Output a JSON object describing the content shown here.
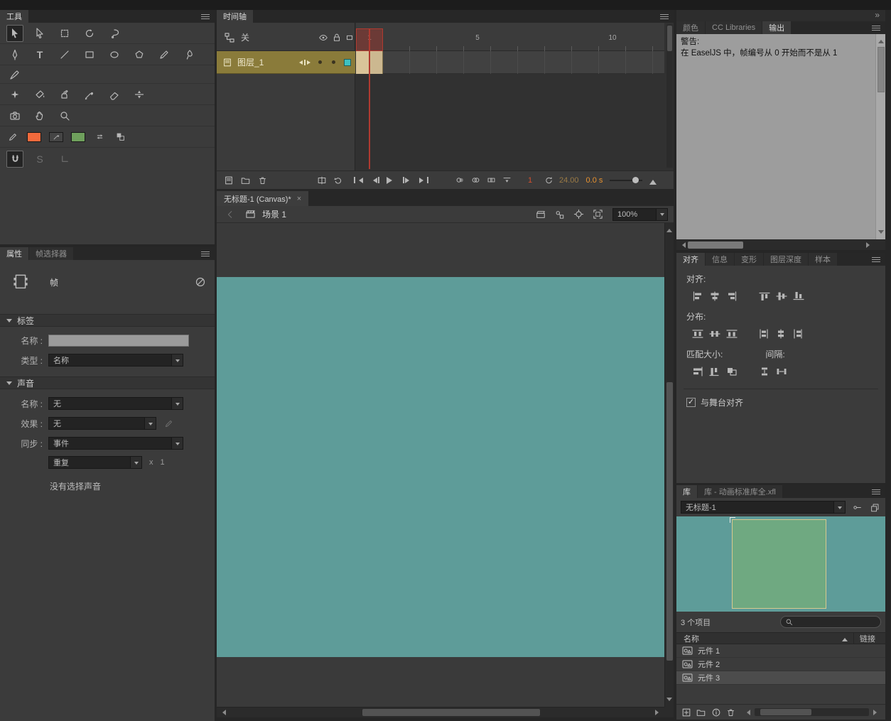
{
  "colors": {
    "stage": "#5e9c99",
    "preview_green": "#6fa981",
    "layer_selected": "#8a7b3a",
    "keyframe_cell": "#d9c499",
    "playhead_red": "#b03a30",
    "accent_orange": "#e8922f",
    "frame_red": "#d4502e",
    "stroke_swatch": "#f26a3c",
    "fill_swatch": "#454545",
    "extra_swatch": "#6fa05c",
    "layer_outline": "#3ec1c1"
  },
  "window": {
    "collapse_glyph": "»"
  },
  "tools": {
    "tab": "工具",
    "glyphs": {
      "text": "T",
      "smooth": "S"
    }
  },
  "properties": {
    "tabs": [
      {
        "label": "属性"
      },
      {
        "label": "帧选择器"
      }
    ],
    "object_type": "帧",
    "sections": {
      "label": {
        "title": "标签",
        "name_label": "名称 :",
        "type_label": "类型 :",
        "type_value": "名称"
      },
      "sound": {
        "title": "声音",
        "name_label": "名称 :",
        "name_value": "无",
        "effect_label": "效果 :",
        "effect_value": "无",
        "sync_label": "同步 :",
        "sync_value": "事件",
        "repeat_value": "重复",
        "times_label": "x",
        "times_value": "1",
        "status": "没有选择声音"
      }
    }
  },
  "timeline": {
    "tab": "时间轴",
    "parent_view_label": "关",
    "layer_name": "图层_1",
    "ruler_numbers": [
      "1",
      "5",
      "10"
    ],
    "current_frame": "1",
    "fps": "24.00",
    "elapsed": "0.0 s"
  },
  "document": {
    "tab_title": "无标题-1 (Canvas)*",
    "close_glyph": "×",
    "scene_label": "场景 1",
    "zoom_value": "100%"
  },
  "output": {
    "tabs": [
      {
        "label": "颜色"
      },
      {
        "label": "CC Libraries"
      },
      {
        "label": "输出"
      }
    ],
    "warning_title": "警告:",
    "warning_body": "在 EaselJS 中，帧编号从 0 开始而不是从 1"
  },
  "align": {
    "tabs": [
      {
        "label": "对齐"
      },
      {
        "label": "信息"
      },
      {
        "label": "变形"
      },
      {
        "label": "图层深度"
      },
      {
        "label": "样本"
      }
    ],
    "align_label": "对齐:",
    "distribute_label": "分布:",
    "match_label": "匹配大小:",
    "space_label": "间隔:",
    "stage_checkbox_label": "与舞台对齐",
    "check_glyph": "✓"
  },
  "library": {
    "tabs": [
      {
        "label": "库"
      },
      {
        "label": "库 - 动画标准库全.xfl"
      }
    ],
    "doc_select_value": "无标题-1",
    "item_count": "3 个项目",
    "name_column": "名称",
    "link_column": "链接",
    "items": [
      {
        "name": "元件 1"
      },
      {
        "name": "元件 2"
      },
      {
        "name": "元件 3"
      }
    ]
  }
}
